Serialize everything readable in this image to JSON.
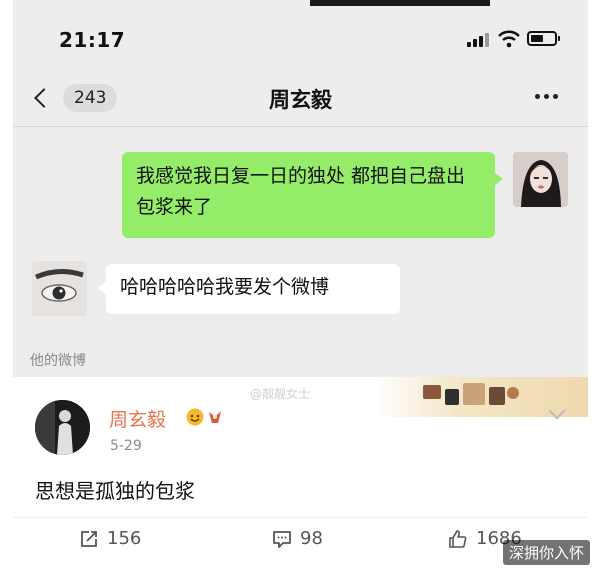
{
  "status_bar": {
    "time": "21:17"
  },
  "nav": {
    "unread_count": "243",
    "title": "周玄毅"
  },
  "messages": {
    "me": "我感觉我日复一日的独处 都把自己盘出包浆来了",
    "other": "哈哈哈哈哈我要发个微博"
  },
  "section_label": "他的微博",
  "post": {
    "watermark": "@靓靓女士",
    "author": "周玄毅",
    "date": "5-29",
    "text": "思想是孤独的包浆",
    "reposts": "156",
    "comments": "98",
    "likes": "1686"
  },
  "brand_watermark": "深拥你入怀",
  "colors": {
    "bubble_me": "#95ec69",
    "author_name": "#eb7350",
    "background": "#ededed"
  }
}
